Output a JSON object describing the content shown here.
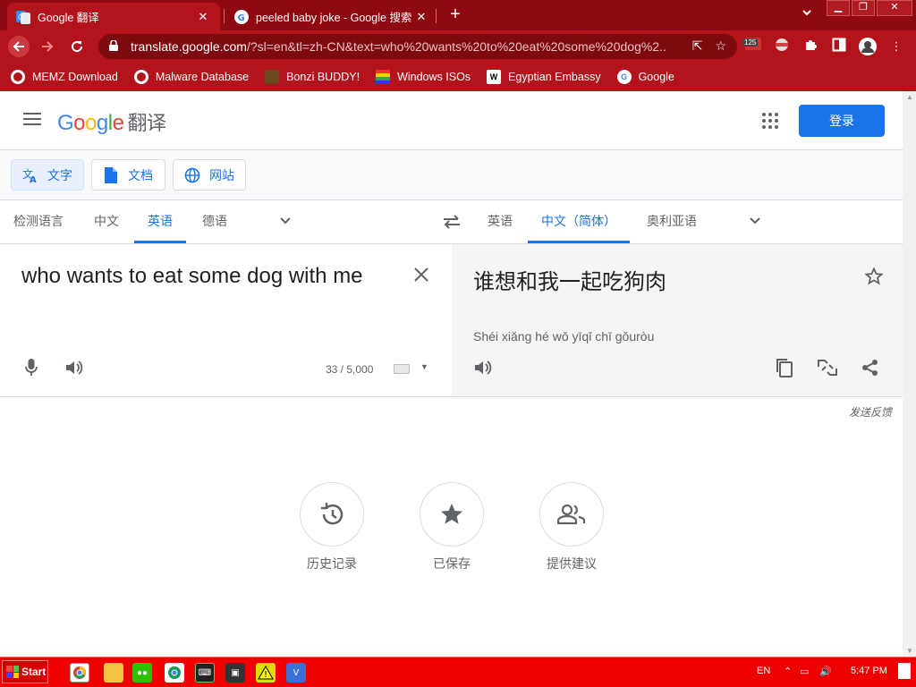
{
  "browser": {
    "tabs": [
      {
        "title": "Google 翻译",
        "active": true
      },
      {
        "title": "peeled baby joke - Google 搜索",
        "active": false
      }
    ],
    "url_host": "translate.google.com",
    "url_rest": "/?sl=en&tl=zh-CN&text=who%20wants%20to%20eat%20some%20dog%2...",
    "extension_badge": "125",
    "bookmarks": [
      {
        "label": "MEMZ Download",
        "icon": "globe-icon"
      },
      {
        "label": "Malware Database",
        "icon": "globe-icon"
      },
      {
        "label": "Bonzi BUDDY!",
        "icon": "bonzi-icon"
      },
      {
        "label": "Windows ISOs",
        "icon": "windows-icon"
      },
      {
        "label": "Egyptian Embassy",
        "icon": "wix-icon"
      },
      {
        "label": "Google",
        "icon": "google-icon"
      }
    ]
  },
  "translate": {
    "logo_text": "Google",
    "product_name": "翻译",
    "login_label": "登录",
    "modes": [
      {
        "label": "文字",
        "icon": "translate-icon",
        "active": true
      },
      {
        "label": "文档",
        "icon": "document-icon",
        "active": false
      },
      {
        "label": "网站",
        "icon": "globe-icon",
        "active": false
      }
    ],
    "source_langs": [
      "检测语言",
      "中文",
      "英语",
      "德语"
    ],
    "source_active": "英语",
    "target_langs": [
      "英语",
      "中文（简体）",
      "奥利亚语"
    ],
    "target_active": "中文（简体）",
    "source_text": "who wants to eat some dog with me",
    "char_count": "33 / 5,000",
    "target_text": "谁想和我一起吃狗肉",
    "pinyin": "Shéi xiǎng hé wǒ yīqǐ chī gǒuròu",
    "feedback": "发送反馈",
    "bottom_actions": [
      {
        "label": "历史记录",
        "icon": "history-icon"
      },
      {
        "label": "已保存",
        "icon": "star-icon"
      },
      {
        "label": "提供建议",
        "icon": "people-icon"
      }
    ]
  },
  "taskbar": {
    "start_label": "Start",
    "lang": "EN",
    "time": "5:47 PM"
  },
  "colors": {
    "chrome_frame": "#8f0a10",
    "chrome_toolbar": "#b3141c",
    "accent": "#1a73e8",
    "taskbar": "#ee0000"
  }
}
